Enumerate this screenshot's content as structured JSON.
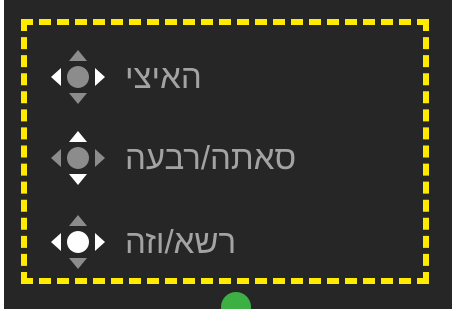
{
  "menu": {
    "items": [
      {
        "label": "האיצי",
        "highlight": "left-right"
      },
      {
        "label": "סאתה/רבעה",
        "highlight": "up-down"
      },
      {
        "label": "רשא/וזה",
        "highlight": "center-left-right"
      }
    ]
  },
  "colors": {
    "background": "#262626",
    "focus_frame": "#ffeb00",
    "label_text": "#a3a3a3",
    "dpad_dim": "#8c8c8c",
    "dpad_active": "#ffffff",
    "home_dot": "#3cb043"
  }
}
